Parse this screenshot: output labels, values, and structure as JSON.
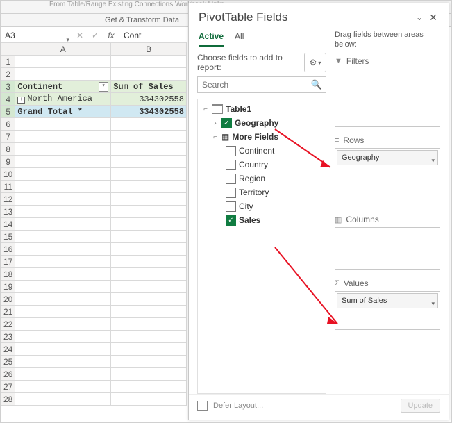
{
  "ribbon": {
    "top_items": "From Table/Range   Existing Connections       Workbook Links",
    "group": "Get & Transform Data"
  },
  "formula_bar": {
    "name_box": "A3",
    "formula_preview": "Cont"
  },
  "grid": {
    "columns": [
      "A",
      "B"
    ],
    "pivot": {
      "row_header": "Continent",
      "value_header": "Sum of Sales",
      "rows": [
        {
          "label": "North America",
          "value": "334302558",
          "expandable": true
        }
      ],
      "grand_total_label": "Grand Total *",
      "grand_total_value": "334302558"
    }
  },
  "pane": {
    "title": "PivotTable Fields",
    "tabs": {
      "active": "Active",
      "all": "All"
    },
    "choose_text": "Choose fields to add to report:",
    "search_placeholder": "Search",
    "tree": {
      "table": "Table1",
      "geography": "Geography",
      "more_fields": "More Fields",
      "fields": {
        "continent": "Continent",
        "country": "Country",
        "region": "Region",
        "territory": "Territory",
        "city": "City",
        "sales": "Sales"
      }
    },
    "drag_hint": "Drag fields between areas below:",
    "areas": {
      "filters": "Filters",
      "rows": "Rows",
      "columns": "Columns",
      "values": "Values"
    },
    "pills": {
      "rows": "Geography",
      "values": "Sum of Sales"
    },
    "defer": "Defer Layout...",
    "update": "Update"
  },
  "colors": {
    "accent": "#107c41"
  }
}
